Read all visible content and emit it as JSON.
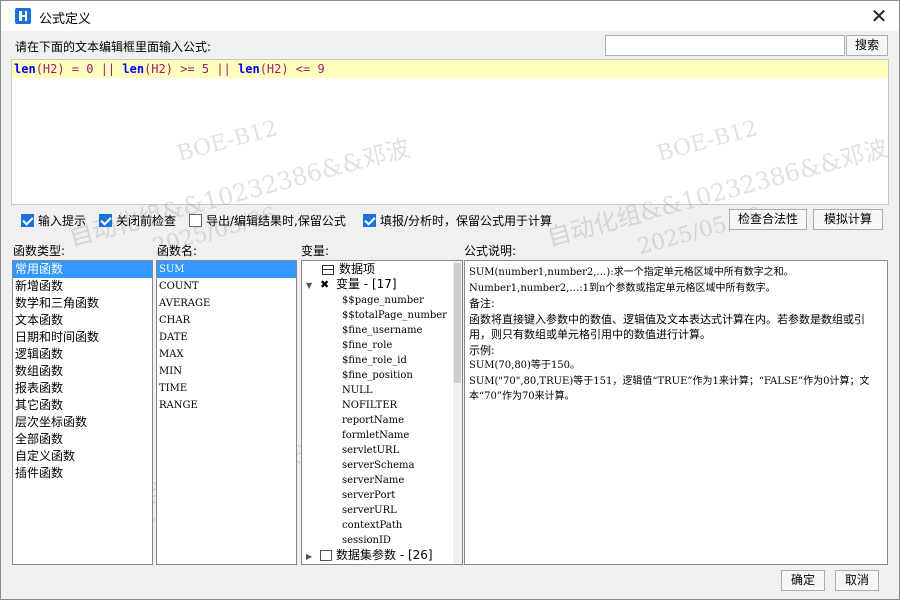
{
  "window": {
    "title": "公式定义",
    "close_glyph": "✕"
  },
  "prompt": "请在下面的文本编辑框里面输入公式:",
  "search": {
    "value": "",
    "button_label": "搜索"
  },
  "formula": {
    "segments": [
      {
        "text": "len",
        "kind": "kw"
      },
      {
        "text": "(H2) = 0 || ",
        "kind": "tok"
      },
      {
        "text": "len",
        "kind": "kw"
      },
      {
        "text": "(H2) >= 5 || ",
        "kind": "tok"
      },
      {
        "text": "len",
        "kind": "kw"
      },
      {
        "text": "(H2) <= 9",
        "kind": "tok"
      }
    ]
  },
  "options": [
    {
      "label": "输入提示",
      "checked": true
    },
    {
      "label": "关闭前检查",
      "checked": true
    },
    {
      "label": "导出/编辑结果时,保留公式",
      "checked": false
    },
    {
      "label": "填报/分析时，保留公式用于计算",
      "checked": true
    }
  ],
  "actions": {
    "check_validity": "检查合法性",
    "simulate": "模拟计算"
  },
  "labels": {
    "function_type": "函数类型:",
    "function_name": "函数名:",
    "variables": "变量:",
    "description": "公式说明:"
  },
  "function_types": [
    {
      "label": "常用函数",
      "selected": true
    },
    {
      "label": "新增函数",
      "selected": false
    },
    {
      "label": "数学和三角函数",
      "selected": false
    },
    {
      "label": "文本函数",
      "selected": false
    },
    {
      "label": "日期和时间函数",
      "selected": false
    },
    {
      "label": "逻辑函数",
      "selected": false
    },
    {
      "label": "数组函数",
      "selected": false
    },
    {
      "label": "报表函数",
      "selected": false
    },
    {
      "label": "其它函数",
      "selected": false
    },
    {
      "label": "层次坐标函数",
      "selected": false
    },
    {
      "label": "全部函数",
      "selected": false
    },
    {
      "label": "自定义函数",
      "selected": false
    },
    {
      "label": "插件函数",
      "selected": false
    }
  ],
  "function_names": [
    {
      "label": "SUM",
      "selected": true
    },
    {
      "label": "COUNT",
      "selected": false
    },
    {
      "label": "AVERAGE",
      "selected": false
    },
    {
      "label": "CHAR",
      "selected": false
    },
    {
      "label": "DATE",
      "selected": false
    },
    {
      "label": "MAX",
      "selected": false
    },
    {
      "label": "MIN",
      "selected": false
    },
    {
      "label": "TIME",
      "selected": false
    },
    {
      "label": "RANGE",
      "selected": false
    }
  ],
  "variables_tree": {
    "data_item": "数据项",
    "var_group": "变量 - [17]",
    "vars": [
      "$$page_number",
      "$$totalPage_number",
      "$fine_username",
      "$fine_role",
      "$fine_role_id",
      "$fine_position",
      "NULL",
      "NOFILTER",
      "reportName",
      "formletName",
      "servletURL",
      "serverSchema",
      "serverName",
      "serverPort",
      "serverURL",
      "contextPath",
      "sessionID"
    ],
    "dataset_group": "数据集参数 - [26]"
  },
  "description": {
    "lines": [
      "SUM(number1,number2,…):求一个指定单元格区域中所有数字之和。",
      "Number1,number2,…:1到n个参数或指定单元格区域中所有数字。",
      "备注:",
      "函数将直接键入参数中的数值、逻辑值及文本表达式计算在内。若参数是数组或引用，则只有数组或单元格引用中的数值进行计算。",
      "示例:",
      "SUM(70,80)等于150。",
      "SUM(\"70\",80,TRUE)等于151，逻辑值“TRUE”作为1来计算；“FALSE”作为0计算；文本“70”作为70来计算。"
    ]
  },
  "footer": {
    "ok": "确定",
    "cancel": "取消"
  },
  "watermarks": [
    "BOE-B12",
    "自动化组&&10232386&&邓波",
    "2025/05/06"
  ]
}
